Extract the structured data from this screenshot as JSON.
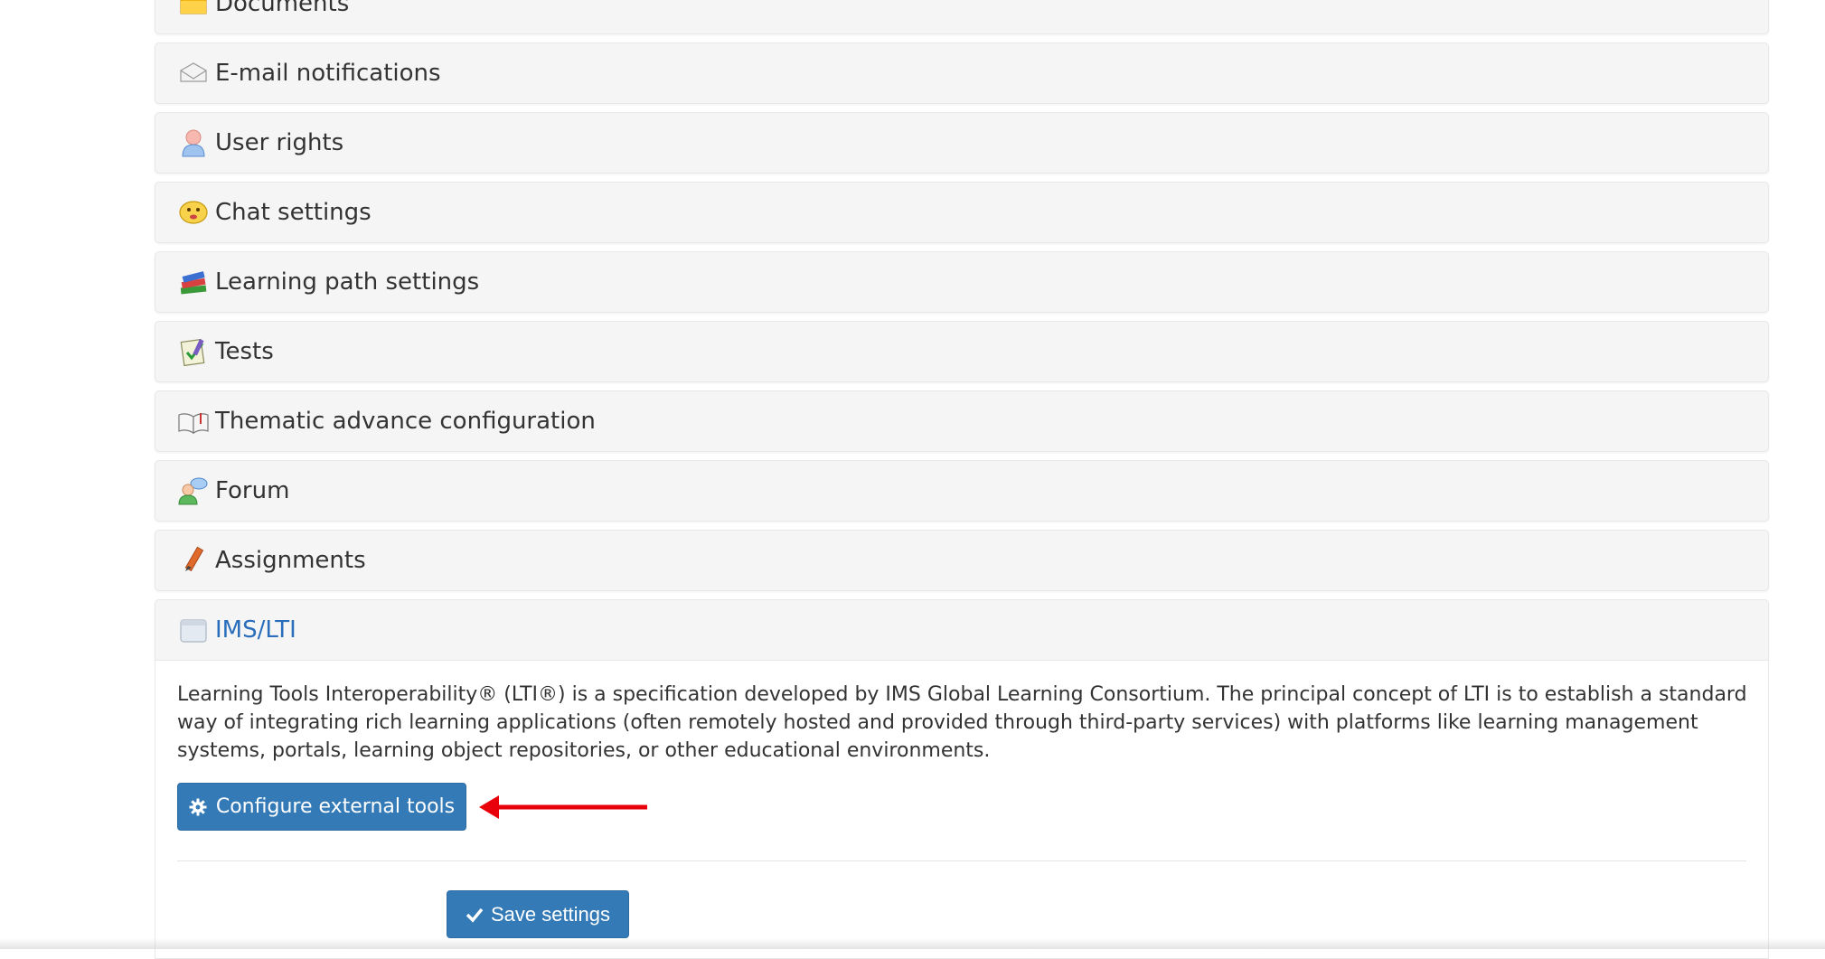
{
  "sections": [
    {
      "label": "Documents",
      "icon": "folder-icon"
    },
    {
      "label": "E-mail notifications",
      "icon": "envelope-icon"
    },
    {
      "label": "User rights",
      "icon": "user-icon"
    },
    {
      "label": "Chat settings",
      "icon": "chat-face-icon"
    },
    {
      "label": "Learning path settings",
      "icon": "books-icon"
    },
    {
      "label": "Tests",
      "icon": "quiz-icon"
    },
    {
      "label": "Thematic advance configuration",
      "icon": "open-book-icon"
    },
    {
      "label": "Forum",
      "icon": "forum-users-icon"
    },
    {
      "label": "Assignments",
      "icon": "pencil-icon"
    },
    {
      "label": "IMS/LTI",
      "icon": "lti-icon"
    }
  ],
  "lti": {
    "description": "Learning Tools Interoperability® (LTI®) is a specification developed by IMS Global Learning Consortium. The principal concept of LTI is to establish a standard way of integrating rich learning applications (often remotely hosted and provided through third-party services) with platforms like learning management systems, portals, learning object repositories, or other educational environments.",
    "configure_label": "Configure external tools"
  },
  "save_label": "Save settings",
  "colors": {
    "primary": "#337ab7",
    "link": "#2a6ebb",
    "annotation_arrow": "#e8000b"
  }
}
